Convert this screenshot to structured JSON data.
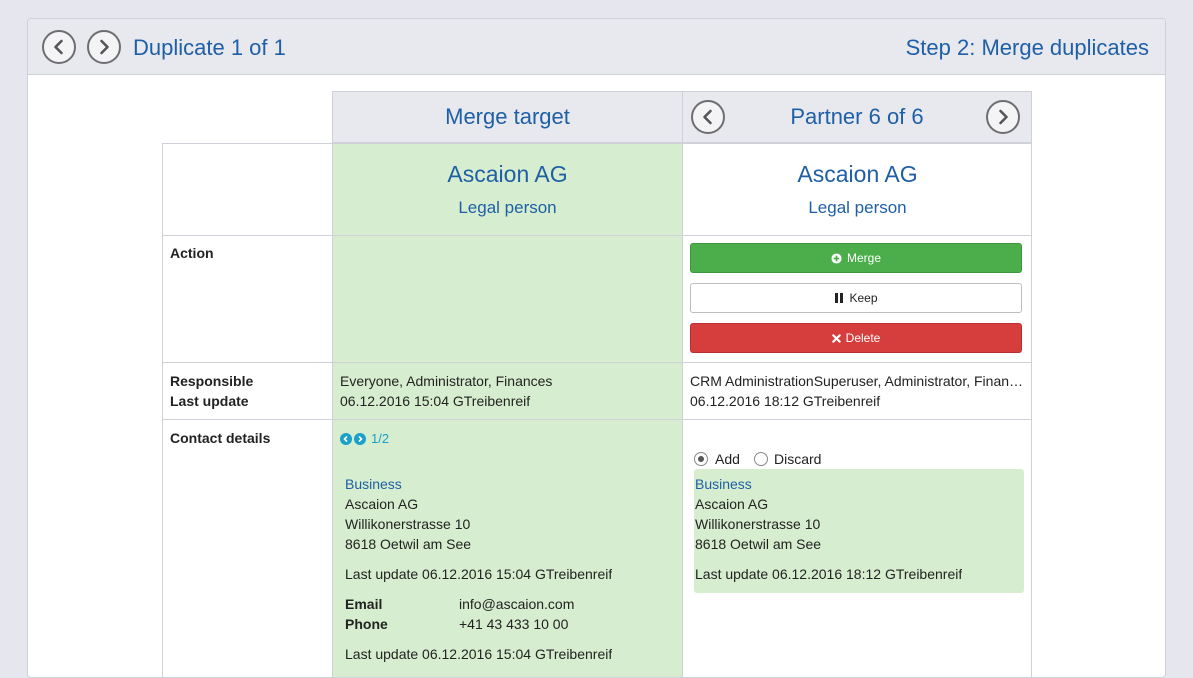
{
  "header": {
    "duplicate_title": "Duplicate 1 of 1",
    "step_title": "Step 2: Merge duplicates"
  },
  "columns": {
    "merge_target": "Merge target",
    "partner": "Partner 6 of 6"
  },
  "target": {
    "name": "Ascaion AG",
    "type": "Legal person",
    "responsible": "Everyone, Administrator, Finances",
    "last_update": "06.12.2016 15:04 GTreibenreif",
    "contact_pager": "1/2",
    "address": {
      "label": "Business",
      "line1": "Ascaion AG",
      "line2": "Willikonerstrasse 10",
      "line3": "8618 Oetwil am See",
      "last_update": "Last update 06.12.2016 15:04 GTreibenreif"
    },
    "email_label": "Email",
    "email_value": "info@ascaion.com",
    "phone_label": "Phone",
    "phone_value": "+41 43 433 10 00",
    "contact_last_update": "Last update 06.12.2016 15:04 GTreibenreif"
  },
  "partner": {
    "name": "Ascaion AG",
    "type": "Legal person",
    "responsible": "CRM AdministrationSuperuser, Administrator, Finances",
    "last_update": "06.12.2016 18:12 GTreibenreif",
    "add_label": "Add",
    "discard_label": "Discard",
    "address": {
      "label": "Business",
      "line1": "Ascaion AG",
      "line2": "Willikonerstrasse 10",
      "line3": "8618 Oetwil am See",
      "last_update": "Last update 06.12.2016 18:12 GTreibenreif"
    }
  },
  "rows": {
    "action": "Action",
    "responsible": "Responsible",
    "last_update": "Last update",
    "contact_details": "Contact details"
  },
  "actions": {
    "merge": "Merge",
    "keep": "Keep",
    "delete": "Delete"
  },
  "colors": {
    "accent": "#1f5fa6",
    "merge": "#4bae4a",
    "delete": "#d63e3e",
    "highlight": "#d6eecf"
  }
}
